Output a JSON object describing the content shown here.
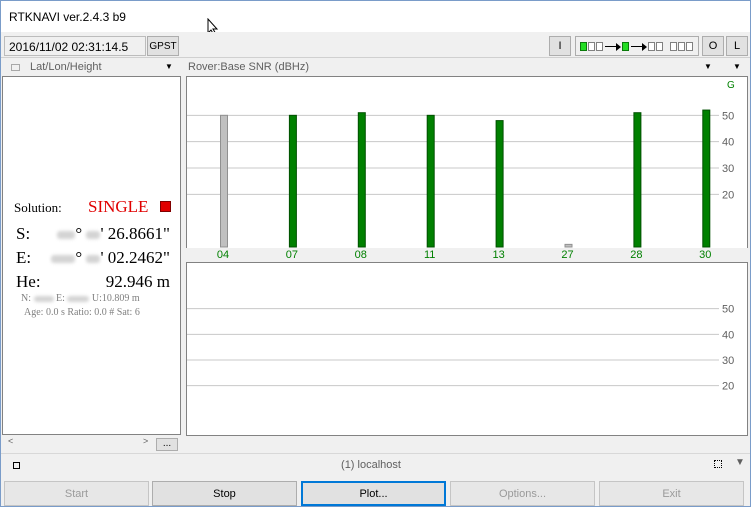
{
  "window": {
    "title": "RTKNAVI ver.2.4.3 b9"
  },
  "toolbar": {
    "time": "2016/11/02 02:31:14.5",
    "time_system": "GPST",
    "btn_i": "I",
    "btn_o": "O",
    "btn_l": "L"
  },
  "left_panel": {
    "header": "Lat/Lon/Height",
    "solution_label": "Solution:",
    "solution_value": "SINGLE",
    "solution_color": "#e00000",
    "lat_label": "S:",
    "lat_value": "' 26.8661\"",
    "lon_label": "E:",
    "lon_value": "' 02.2462\"",
    "height_label": "He:",
    "height_value": "92.946 m",
    "neu_n": "N:",
    "neu_e": "E:",
    "neu_u": "U:10.809 m",
    "stats": "Age: 0.0 s Ratio: 0.0 # Sat: 6",
    "ellipsis": "..."
  },
  "right_panel": {
    "header": "Rover:Base SNR (dBHz)",
    "legend_label": "G",
    "legend_color": "#008000"
  },
  "chart_data": [
    {
      "type": "bar",
      "categories": [
        "04",
        "07",
        "08",
        "11",
        "13",
        "27",
        "28",
        "30"
      ],
      "values": [
        50,
        50,
        51,
        50,
        48,
        1,
        51,
        52
      ],
      "colors": [
        "#c0c0c0",
        "#008000",
        "#008000",
        "#008000",
        "#008000",
        "#c0c0c0",
        "#008000",
        "#008000"
      ],
      "ylim": [
        0,
        60
      ],
      "yticks": [
        20,
        30,
        40,
        50
      ],
      "grid": true,
      "legend": "top-right"
    },
    {
      "type": "bar",
      "categories": [],
      "values": [],
      "ylim": [
        0,
        60
      ],
      "yticks": [
        20,
        30,
        40,
        50
      ],
      "grid": true
    }
  ],
  "status": {
    "text": "(1) localhost"
  },
  "buttons": {
    "start": "Start",
    "stop": "Stop",
    "plot": "Plot...",
    "options": "Options...",
    "exit": "Exit"
  }
}
